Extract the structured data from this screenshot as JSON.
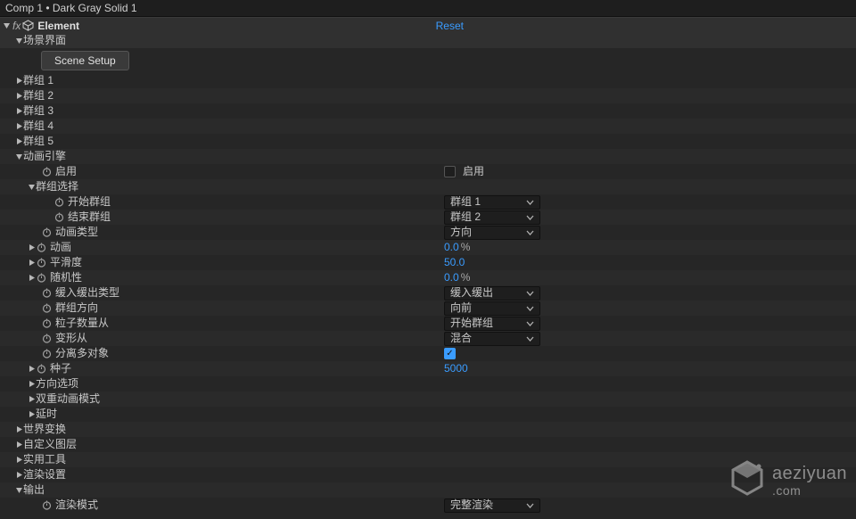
{
  "breadcrumb": "Comp 1 • Dark Gray Solid 1",
  "effect": {
    "prefix": "fx",
    "name": "Element",
    "reset": "Reset"
  },
  "sceneInterface": {
    "label": "场景界面",
    "button": "Scene Setup"
  },
  "groups": [
    "群组 1",
    "群组 2",
    "群组 3",
    "群组 4",
    "群组 5"
  ],
  "animEngine": {
    "label": "动画引擎",
    "enable": {
      "label": "启用",
      "valueLabel": "启用",
      "checked": false
    },
    "groupSelect": {
      "label": "群组选择",
      "start": {
        "label": "开始群组",
        "value": "群组 1"
      },
      "end": {
        "label": "结束群组",
        "value": "群组 2"
      }
    },
    "animType": {
      "label": "动画类型",
      "value": "方向"
    },
    "anim": {
      "label": "动画",
      "value": "0.0",
      "pct": "%"
    },
    "smooth": {
      "label": "平滑度",
      "value": "50.0"
    },
    "random": {
      "label": "随机性",
      "value": "0.0",
      "pct": "%"
    },
    "easeType": {
      "label": "缓入缓出类型",
      "value": "缓入缓出"
    },
    "groupDir": {
      "label": "群组方向",
      "value": "向前"
    },
    "particleFrom": {
      "label": "粒子数量从",
      "value": "开始群组"
    },
    "morphFrom": {
      "label": "变形从",
      "value": "混合"
    },
    "separateMulti": {
      "label": "分离多对象",
      "checked": true
    },
    "seed": {
      "label": "种子",
      "value": "5000"
    },
    "dirOptions": "方向选项",
    "dualAnim": "双重动画模式",
    "delay": "延时"
  },
  "worldTransform": "世界变换",
  "customLayers": "自定义图层",
  "utilities": "实用工具",
  "renderSettings": "渲染设置",
  "output": {
    "label": "输出",
    "renderMode": {
      "label": "渲染模式",
      "value": "完整渲染"
    }
  },
  "watermark": {
    "main": "aeziyuan",
    "sub": ".com"
  }
}
